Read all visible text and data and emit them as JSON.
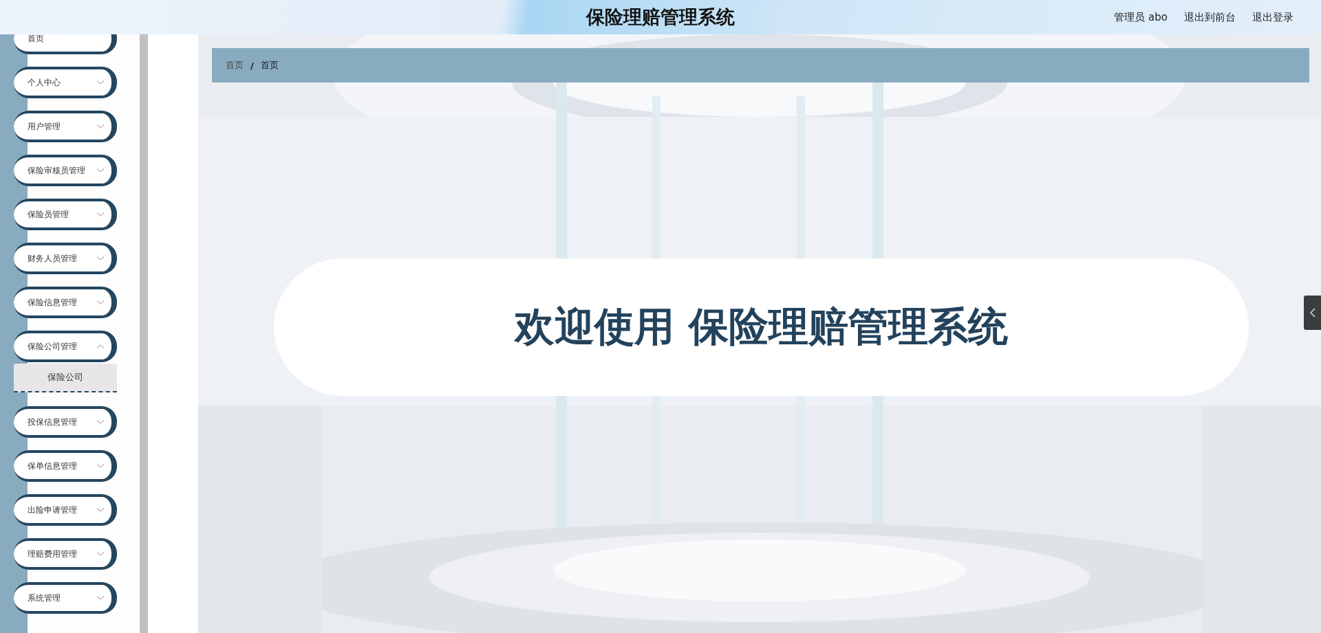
{
  "header": {
    "title": "保险理赔管理系统",
    "links": [
      "管理员 abo",
      "退出到前台",
      "退出登录"
    ]
  },
  "sidebar": {
    "items": [
      {
        "label": "首页",
        "kind": "link"
      },
      {
        "label": "个人中心",
        "kind": "menu",
        "expanded": false
      },
      {
        "label": "用户管理",
        "kind": "menu",
        "expanded": false
      },
      {
        "label": "保险审核员管理",
        "kind": "menu",
        "expanded": false
      },
      {
        "label": "保险员管理",
        "kind": "menu",
        "expanded": false
      },
      {
        "label": "财务人员管理",
        "kind": "menu",
        "expanded": false
      },
      {
        "label": "保险信息管理",
        "kind": "menu",
        "expanded": false
      },
      {
        "label": "保险公司管理",
        "kind": "menu",
        "expanded": true,
        "children": [
          {
            "label": "保险公司"
          }
        ]
      },
      {
        "label": "投保信息管理",
        "kind": "menu",
        "expanded": false
      },
      {
        "label": "保单信息管理",
        "kind": "menu",
        "expanded": false
      },
      {
        "label": "出险申请管理",
        "kind": "menu",
        "expanded": false
      },
      {
        "label": "理赔费用管理",
        "kind": "menu",
        "expanded": false
      },
      {
        "label": "系统管理",
        "kind": "menu",
        "expanded": false
      }
    ]
  },
  "breadcrumb": {
    "items": [
      "首页",
      "首页"
    ],
    "separator": "/"
  },
  "welcome": {
    "text": "欢迎使用 保险理赔管理系统"
  }
}
